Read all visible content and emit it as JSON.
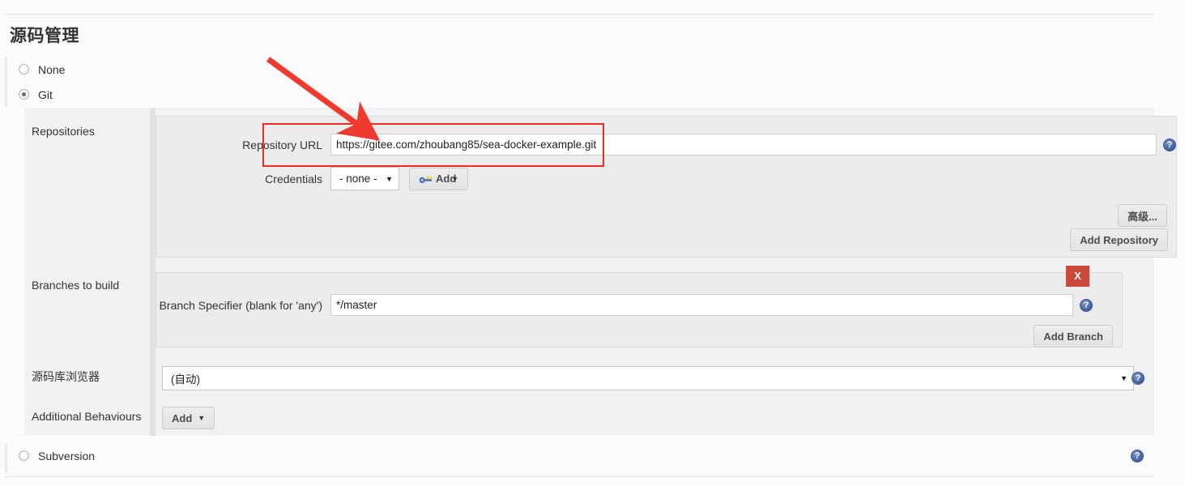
{
  "page": {
    "title": "源码管理"
  },
  "scm_options": [
    {
      "label": "None",
      "selected": false
    },
    {
      "label": "Git",
      "selected": true
    },
    {
      "label": "Subversion",
      "selected": false
    }
  ],
  "git": {
    "repositories": {
      "label": "Repositories",
      "repository_url": {
        "label": "Repository URL",
        "value": "https://gitee.com/zhoubang85/sea-docker-example.git",
        "placeholder": ""
      },
      "credentials": {
        "label": "Credentials",
        "selected": "- none -",
        "options": [
          "- none -"
        ],
        "add_button": "Add",
        "add_icon": "key-icon",
        "caret_icon": "chevron-down-icon"
      },
      "advanced_button": "高级...",
      "add_repository_button": "Add Repository"
    },
    "branches": {
      "label": "Branches to build",
      "branch_specifier": {
        "label": "Branch Specifier (blank for 'any')",
        "value": "*/master",
        "placeholder": ""
      },
      "delete_button": "X",
      "add_branch_button": "Add Branch"
    },
    "repository_browser": {
      "label": "源码库浏览器",
      "selected": "(自动)",
      "options": [
        "(自动)"
      ],
      "caret_icon": "chevron-down-icon"
    },
    "additional_behaviours": {
      "label": "Additional Behaviours",
      "add_button": "Add",
      "caret_icon": "chevron-down-icon"
    }
  },
  "help_icon": {
    "glyph": "?",
    "name": "help-icon"
  },
  "annotation": {
    "highlight_color": "#ef2b28",
    "arrow_color": "#ef3b2f"
  }
}
